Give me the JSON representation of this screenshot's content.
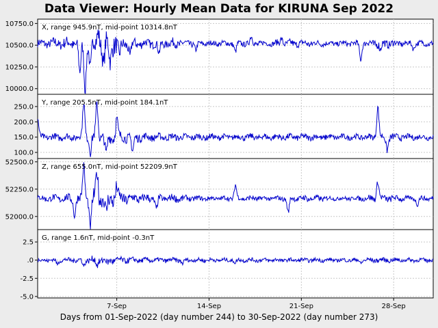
{
  "title": "Data Viewer:  Hourly Mean Data for KIRUNA Sep 2022",
  "footer": "Days from 01-Sep-2022 (day number 244) to 30-Sep-2022 (day number 273)",
  "colors": {
    "line": "#0000cc",
    "grid": "#c8c8c8",
    "background": "#ececec",
    "panel": "#ffffff"
  },
  "chart_data": [
    {
      "type": "line",
      "component": "X",
      "label": "X, range 945.9nT, mid-point 10314.8nT",
      "ylim": [
        9935,
        10800
      ],
      "yticks": [
        10000.0,
        10250.0,
        10500.0,
        10750.0
      ],
      "ytick_labels": [
        "10000.0",
        "10250.0",
        "10500.0",
        "10750.0"
      ],
      "baseline": 10520,
      "spikes": [
        [
          4.2,
          -350
        ],
        [
          4.6,
          -520
        ],
        [
          5.0,
          -300
        ],
        [
          5.6,
          150
        ],
        [
          6.0,
          -250
        ],
        [
          6.5,
          -200
        ],
        [
          7.2,
          -150
        ],
        [
          8.0,
          -150
        ],
        [
          10.2,
          -120
        ],
        [
          13.0,
          -80
        ],
        [
          16.0,
          -100
        ],
        [
          17.2,
          70
        ],
        [
          19.5,
          60
        ],
        [
          25.5,
          -180
        ],
        [
          27.0,
          -80
        ],
        [
          29.5,
          -60
        ]
      ],
      "noise": [
        1.1,
        1.4,
        1.6,
        1.7,
        2.6,
        2.9,
        1.8,
        1.4,
        1.2,
        1.1,
        1.3,
        0.9,
        0.7,
        0.7,
        0.8,
        0.8,
        0.9,
        0.7,
        0.9,
        1.0,
        1.0,
        0.8,
        0.7,
        0.7,
        0.8,
        1.3,
        1.1,
        0.8,
        0.7,
        0.8
      ]
    },
    {
      "type": "line",
      "component": "Y",
      "label": "Y, range 205.5nT, mid-point 184.1nT",
      "ylim": [
        80,
        290
      ],
      "yticks": [
        100.0,
        150.0,
        200.0,
        250.0
      ],
      "ytick_labels": [
        "100.0",
        "150.0",
        "200.0",
        "250.0"
      ],
      "baseline": 150,
      "spikes": [
        [
          1.0,
          60
        ],
        [
          4.5,
          115
        ],
        [
          5.0,
          -50
        ],
        [
          5.5,
          110
        ],
        [
          6.2,
          -60
        ],
        [
          7.0,
          60
        ],
        [
          8.2,
          -50
        ],
        [
          26.8,
          100
        ],
        [
          27.5,
          -40
        ]
      ],
      "noise": [
        1.0,
        1.1,
        1.1,
        1.2,
        1.8,
        2.0,
        1.6,
        1.4,
        1.2,
        1.1,
        1.1,
        1.0,
        1.0,
        1.0,
        0.9,
        1.0,
        1.0,
        1.0,
        1.0,
        1.0,
        1.0,
        1.0,
        0.9,
        0.9,
        0.9,
        1.0,
        1.2,
        1.0,
        0.9,
        0.9
      ]
    },
    {
      "type": "line",
      "component": "Z",
      "label": "Z, range 655.0nT, mid-point 52209.9nT",
      "ylim": [
        51880,
        52530
      ],
      "yticks": [
        52000.0,
        52250.0,
        52500.0
      ],
      "ytick_labels": [
        "52000.0",
        "52250.0",
        "52500.0"
      ],
      "baseline": 52165,
      "spikes": [
        [
          3.8,
          -150
        ],
        [
          4.5,
          300
        ],
        [
          5.0,
          -280
        ],
        [
          5.5,
          250
        ],
        [
          6.2,
          -150
        ],
        [
          7.0,
          100
        ],
        [
          10.0,
          -100
        ],
        [
          16.0,
          120
        ],
        [
          20.0,
          -130
        ],
        [
          26.8,
          160
        ],
        [
          29.8,
          -60
        ]
      ],
      "noise": [
        0.9,
        1.0,
        1.2,
        1.4,
        2.4,
        2.6,
        1.8,
        1.4,
        1.2,
        1.0,
        1.1,
        0.8,
        0.7,
        0.6,
        0.7,
        0.7,
        0.8,
        0.6,
        0.7,
        0.8,
        0.9,
        0.8,
        0.6,
        0.6,
        0.7,
        1.0,
        1.0,
        0.8,
        0.6,
        0.7
      ]
    },
    {
      "type": "line",
      "component": "G",
      "label": "G, range 1.6nT, mid-point -0.3nT",
      "ylim": [
        -5.2,
        4.2
      ],
      "yticks": [
        -5.0,
        -2.5,
        0.0,
        2.5
      ],
      "ytick_labels": [
        "-5.0",
        "-2.5",
        ".0",
        "2.5"
      ],
      "baseline": 0.0,
      "spikes": [
        [
          2.5,
          -0.6
        ],
        [
          4.5,
          -0.8
        ],
        [
          5.5,
          -0.7
        ],
        [
          6.3,
          -0.5
        ],
        [
          12.0,
          -0.5
        ],
        [
          16.0,
          -0.4
        ],
        [
          25.5,
          -0.4
        ]
      ],
      "noise": [
        0.6,
        0.6,
        0.7,
        0.8,
        1.1,
        1.1,
        0.9,
        0.8,
        0.7,
        0.7,
        0.7,
        0.6,
        0.6,
        0.6,
        0.6,
        0.6,
        0.6,
        0.6,
        0.6,
        0.6,
        0.6,
        0.6,
        0.6,
        0.6,
        0.6,
        0.7,
        0.7,
        0.6,
        0.6,
        0.6
      ]
    }
  ],
  "x_axis": {
    "days_range": [
      1,
      31
    ],
    "ticks": [
      7,
      14,
      21,
      28
    ],
    "tick_labels": [
      "7-Sep",
      "14-Sep",
      "21-Sep",
      "28-Sep"
    ]
  }
}
